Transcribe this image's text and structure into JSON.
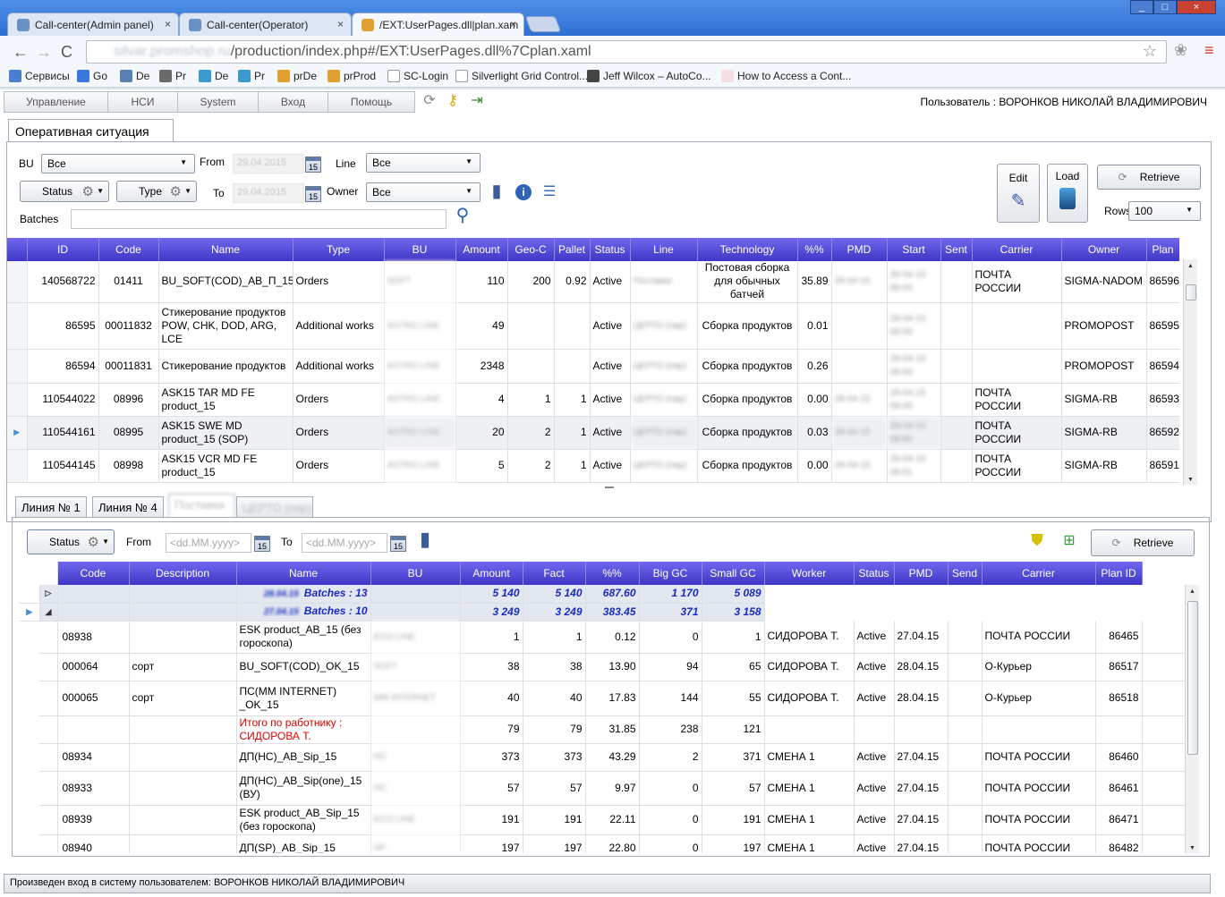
{
  "browser": {
    "tabs": [
      {
        "label": "Call-center(Admin panel)",
        "close": "×"
      },
      {
        "label": "Call-center(Operator)",
        "close": "×"
      },
      {
        "label": "/EXT:UserPages.dll|plan.xam",
        "close": "×"
      }
    ],
    "window_controls": [
      "_",
      "□",
      "×"
    ],
    "nav": {
      "back": "←",
      "forward": "→",
      "reload": "C"
    },
    "url_host": "silvar.promshop.ru",
    "url_path": "/production/index.php#/EXT:UserPages.dll%7Cplan.xaml",
    "bookmarks": [
      "Сервисы",
      "Go",
      "De",
      "Pr",
      "De",
      "Pr",
      "prDe",
      "prProd",
      "SC-Login",
      "Silverlight Grid Control...",
      "Jeff Wilcox – AutoCo...",
      "How to Access a Cont..."
    ]
  },
  "menu": {
    "items": [
      "Управление",
      "НСИ",
      "System",
      "Вход",
      "Помощь"
    ],
    "user": "Пользователь : ВОРОНКОВ НИКОЛАЙ ВЛАДИМИРОВИЧ"
  },
  "page_tab": "Оперативная ситуация",
  "filters": {
    "bu_label": "BU",
    "bu_value": "Все",
    "from_label": "From",
    "from_value": "29.04.2015",
    "line_label": "Line",
    "line_value": "Все",
    "status_btn": "Status",
    "type_btn": "Type",
    "to_label": "To",
    "to_value": "29.04.2015",
    "owner_label": "Owner",
    "owner_value": "Все",
    "batches_label": "Batches",
    "edit_btn": "Edit",
    "load_btn": "Load",
    "retrieve_btn": "Retrieve",
    "rows_label": "Rows",
    "rows_value": "100"
  },
  "grid1": {
    "headers": [
      "ID",
      "Code",
      "Name",
      "Type",
      "BU",
      "Amount",
      "Geo-C",
      "Pallet",
      "Status",
      "Line",
      "Technology",
      "%%",
      "PMD",
      "Start",
      "Sent",
      "Carrier",
      "Owner",
      "Plan"
    ],
    "rows": [
      {
        "id": "140568722",
        "code": "01411",
        "name": "BU_SOFT(COD)_AB_П_15",
        "type": "Orders",
        "bu": "SOFT",
        "amount": "110",
        "geo": "200",
        "pallet": "0.92",
        "status": "Active",
        "line": "Поставки",
        "tech": "Постовая сборка для обычных батчей",
        "pct": "35.89",
        "pmd": "28-04-15",
        "start": "29-04-15 08:00",
        "sent": "",
        "carrier": "ПОЧТА РОССИИ",
        "owner": "SIGMA-NADOM",
        "plan": "86596"
      },
      {
        "id": "86595",
        "code": "00011832",
        "name": "Стикерование продуктов POW, CHK, DOD, ARG, LCE",
        "type": "Additional works",
        "bu": "ASTRO LINE",
        "amount": "49",
        "geo": "",
        "pallet": "",
        "status": "Active",
        "line": "ЦЕРТО (пар)",
        "tech": "Сборка продуктов",
        "pct": "0.01",
        "pmd": "",
        "start": "29-04-15 08:00",
        "sent": "",
        "carrier": "",
        "owner": "PROMOPOST",
        "plan": "86595"
      },
      {
        "id": "86594",
        "code": "00011831",
        "name": "Стикерование продуктов",
        "type": "Additional works",
        "bu": "ASTRO LINE",
        "amount": "2348",
        "geo": "",
        "pallet": "",
        "status": "Active",
        "line": "ЦЕРТО (пар)",
        "tech": "Сборка продуктов",
        "pct": "0.26",
        "pmd": "",
        "start": "29-04-15 08:00",
        "sent": "",
        "carrier": "",
        "owner": "PROMOPOST",
        "plan": "86594"
      },
      {
        "id": "110544022",
        "code": "08996",
        "name": "ASK15 TAR MD FE product_15",
        "type": "Orders",
        "bu": "ASTRO LINE",
        "amount": "4",
        "geo": "1",
        "pallet": "1",
        "status": "Active",
        "line": "ЦЕРТО (пар)",
        "tech": "Сборка продуктов",
        "pct": "0.00",
        "pmd": "28-04-15",
        "start": "29-04-15 08:00",
        "sent": "",
        "carrier": "ПОЧТА РОССИИ",
        "owner": "SIGMA-RB",
        "plan": "86593"
      },
      {
        "id": "110544161",
        "code": "08995",
        "name": "ASK15 SWE MD product_15 (SOP)",
        "type": "Orders",
        "bu": "ASTRO LINE",
        "amount": "20",
        "geo": "2",
        "pallet": "1",
        "status": "Active",
        "line": "ЦЕРТО (пар)",
        "tech": "Сборка продуктов",
        "pct": "0.03",
        "pmd": "28-04-15",
        "start": "29-04-15 08:00",
        "sent": "",
        "carrier": "ПОЧТА РОССИИ",
        "owner": "SIGMA-RB",
        "plan": "86592"
      },
      {
        "id": "110544145",
        "code": "08998",
        "name": "ASK15 VCR MD FE product_15",
        "type": "Orders",
        "bu": "ASTRO LINE",
        "amount": "5",
        "geo": "2",
        "pallet": "1",
        "status": "Active",
        "line": "ЦЕРТО (пар)",
        "tech": "Сборка продуктов",
        "pct": "0.00",
        "pmd": "28-04-15",
        "start": "29-04-15 08:01",
        "sent": "",
        "carrier": "ПОЧТА РОССИИ",
        "owner": "SIGMA-RB",
        "plan": "86591"
      }
    ]
  },
  "subtabs": [
    "Линия № 1",
    "Линия № 4",
    "Поставки",
    "ЦЕРТО (пар)"
  ],
  "filters2": {
    "status_btn": "Status",
    "from_label": "From",
    "from_placeholder": "<dd.MM.yyyy>",
    "to_label": "To",
    "to_placeholder": "<dd.MM.yyyy>",
    "retrieve_btn": "Retrieve"
  },
  "grid2": {
    "headers": [
      "",
      "Code",
      "Description",
      "Name",
      "BU",
      "Amount",
      "Fact",
      "%%",
      "Big GC",
      "Small GC",
      "Worker",
      "Status",
      "PMD",
      "Send",
      "Carrier",
      "Plan ID"
    ],
    "groups": [
      {
        "date": "28.04.15",
        "label": "Batches : 13",
        "amount": "5 140",
        "fact": "5 140",
        "pct": "687.60",
        "big": "1 170",
        "small": "5 089",
        "expander": "▷"
      },
      {
        "date": "27.04.15",
        "label": "Batches : 10",
        "amount": "3 249",
        "fact": "3 249",
        "pct": "383.45",
        "big": "371",
        "small": "3 158",
        "expander": "◢"
      }
    ],
    "rows": [
      {
        "code": "08938",
        "desc": "",
        "name": "ESK product_AB_15 (без гороскопа)",
        "bu": "ECO LINE",
        "amount": "1",
        "fact": "1",
        "pct": "0.12",
        "big": "0",
        "small": "1",
        "worker": "СИДОРОВА Т.",
        "status": "Active",
        "pmd": "27.04.15",
        "send": "",
        "carrier": "ПОЧТА РОССИИ",
        "plan": "86465"
      },
      {
        "code": "000064",
        "desc": "сорт",
        "name": "BU_SOFT(COD)_OK_15",
        "bu": "SOFT",
        "amount": "38",
        "fact": "38",
        "pct": "13.90",
        "big": "94",
        "small": "65",
        "worker": "СИДОРОВА Т.",
        "status": "Active",
        "pmd": "28.04.15",
        "send": "",
        "carrier": "О-Курьер",
        "plan": "86517"
      },
      {
        "code": "000065",
        "desc": "сорт",
        "name": "ПС(MM INTERNET) _OK_15",
        "bu": "MM INTERNET",
        "amount": "40",
        "fact": "40",
        "pct": "17.83",
        "big": "144",
        "small": "55",
        "worker": "СИДОРОВА Т.",
        "status": "Active",
        "pmd": "28.04.15",
        "send": "",
        "carrier": "О-Курьер",
        "plan": "86518"
      },
      {
        "code": "",
        "desc": "",
        "name": "Итого по работнику : СИДОРОВА Т.",
        "bu": "",
        "amount": "79",
        "fact": "79",
        "pct": "31.85",
        "big": "238",
        "small": "121",
        "worker": "",
        "status": "",
        "pmd": "",
        "send": "",
        "carrier": "",
        "plan": ""
      },
      {
        "code": "08934",
        "desc": "",
        "name": "ДП(НС)_AB_Sip_15",
        "bu": "НС",
        "amount": "373",
        "fact": "373",
        "pct": "43.29",
        "big": "2",
        "small": "371",
        "worker": "СМЕНА 1",
        "status": "Active",
        "pmd": "27.04.15",
        "send": "",
        "carrier": "ПОЧТА РОССИИ",
        "plan": "86460"
      },
      {
        "code": "08933",
        "desc": "",
        "name": "ДП(НС)_AB_Sip(one)_15 (ВУ)",
        "bu": "НС",
        "amount": "57",
        "fact": "57",
        "pct": "9.97",
        "big": "0",
        "small": "57",
        "worker": "СМЕНА 1",
        "status": "Active",
        "pmd": "27.04.15",
        "send": "",
        "carrier": "ПОЧТА РОССИИ",
        "plan": "86461"
      },
      {
        "code": "08939",
        "desc": "",
        "name": "ESK product_AB_Sip_15 (без гороскопа)",
        "bu": "ECO LINE",
        "amount": "191",
        "fact": "191",
        "pct": "22.11",
        "big": "0",
        "small": "191",
        "worker": "СМЕНА 1",
        "status": "Active",
        "pmd": "27.04.15",
        "send": "",
        "carrier": "ПОЧТА РОССИИ",
        "plan": "86471"
      },
      {
        "code": "08940",
        "desc": "",
        "name": "ДП(SP)_AB_Sip_15",
        "bu": "SP",
        "amount": "197",
        "fact": "197",
        "pct": "22.80",
        "big": "0",
        "small": "197",
        "worker": "СМЕНА 1",
        "status": "Active",
        "pmd": "27.04.15",
        "send": "",
        "carrier": "ПОЧТА РОССИИ",
        "plan": "86482"
      }
    ]
  },
  "status_bar": "Произведен вход в систему пользователем: ВОРОНКОВ НИКОЛАЙ ВЛАДИМИРОВИЧ",
  "colors": {
    "grid_header": "#4f46d4",
    "group_text": "#1a2bc2",
    "total_text": "#e00000",
    "tabstrip": "#2f6fd2"
  }
}
